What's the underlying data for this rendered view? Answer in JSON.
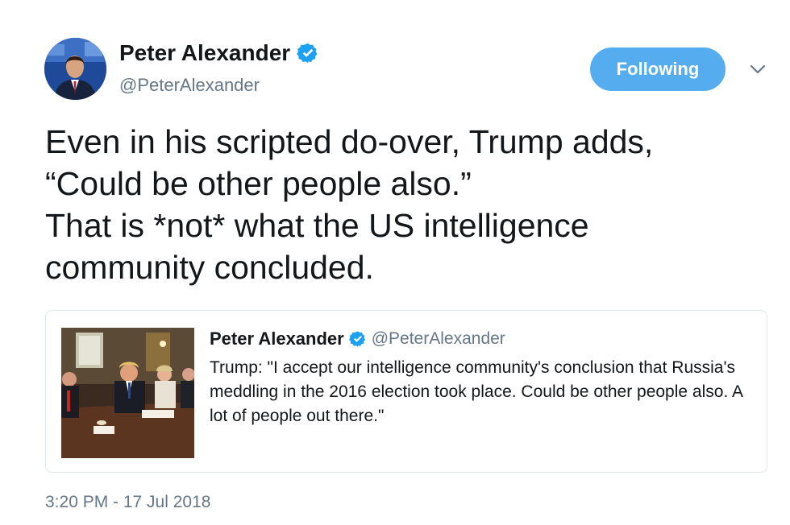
{
  "author": {
    "name": "Peter Alexander",
    "handle": "@PeterAlexander",
    "verified_icon": "verified-badge-icon"
  },
  "follow_button": {
    "label": "Following"
  },
  "menu": {
    "icon": "chevron-down-icon"
  },
  "tweet": {
    "text": "Even in his scripted do-over, Trump adds,\n“Could be other people also.”\nThat is *not* what the US intelligence\ncommunity concluded."
  },
  "quoted_tweet": {
    "name": "Peter Alexander",
    "handle": "@PeterAlexander",
    "text": "Trump: \"I accept our intelligence community's conclusion that Russia's meddling in the 2016 election took place. Could be other people also. A lot of people out there.\""
  },
  "timestamp": "3:20 PM - 17 Jul 2018",
  "colors": {
    "accent": "#55acee",
    "verified": "#1da1f2",
    "secondary_text": "#657786",
    "border": "#e1e8ed"
  }
}
